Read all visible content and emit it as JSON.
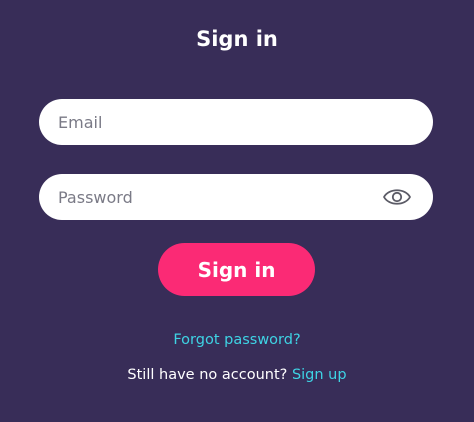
{
  "title": "Sign in",
  "email": {
    "placeholder": "Email",
    "value": ""
  },
  "password": {
    "placeholder": "Password",
    "value": "",
    "toggle_icon": "eye-icon"
  },
  "signin_button": "Sign in",
  "forgot_link": "Forgot password?",
  "signup": {
    "prompt": "Still have no account?",
    "link": "Sign up"
  },
  "colors": {
    "background": "#382d58",
    "button": "#fb2a75",
    "link": "#3ed3e4",
    "field": "#ffffff"
  }
}
